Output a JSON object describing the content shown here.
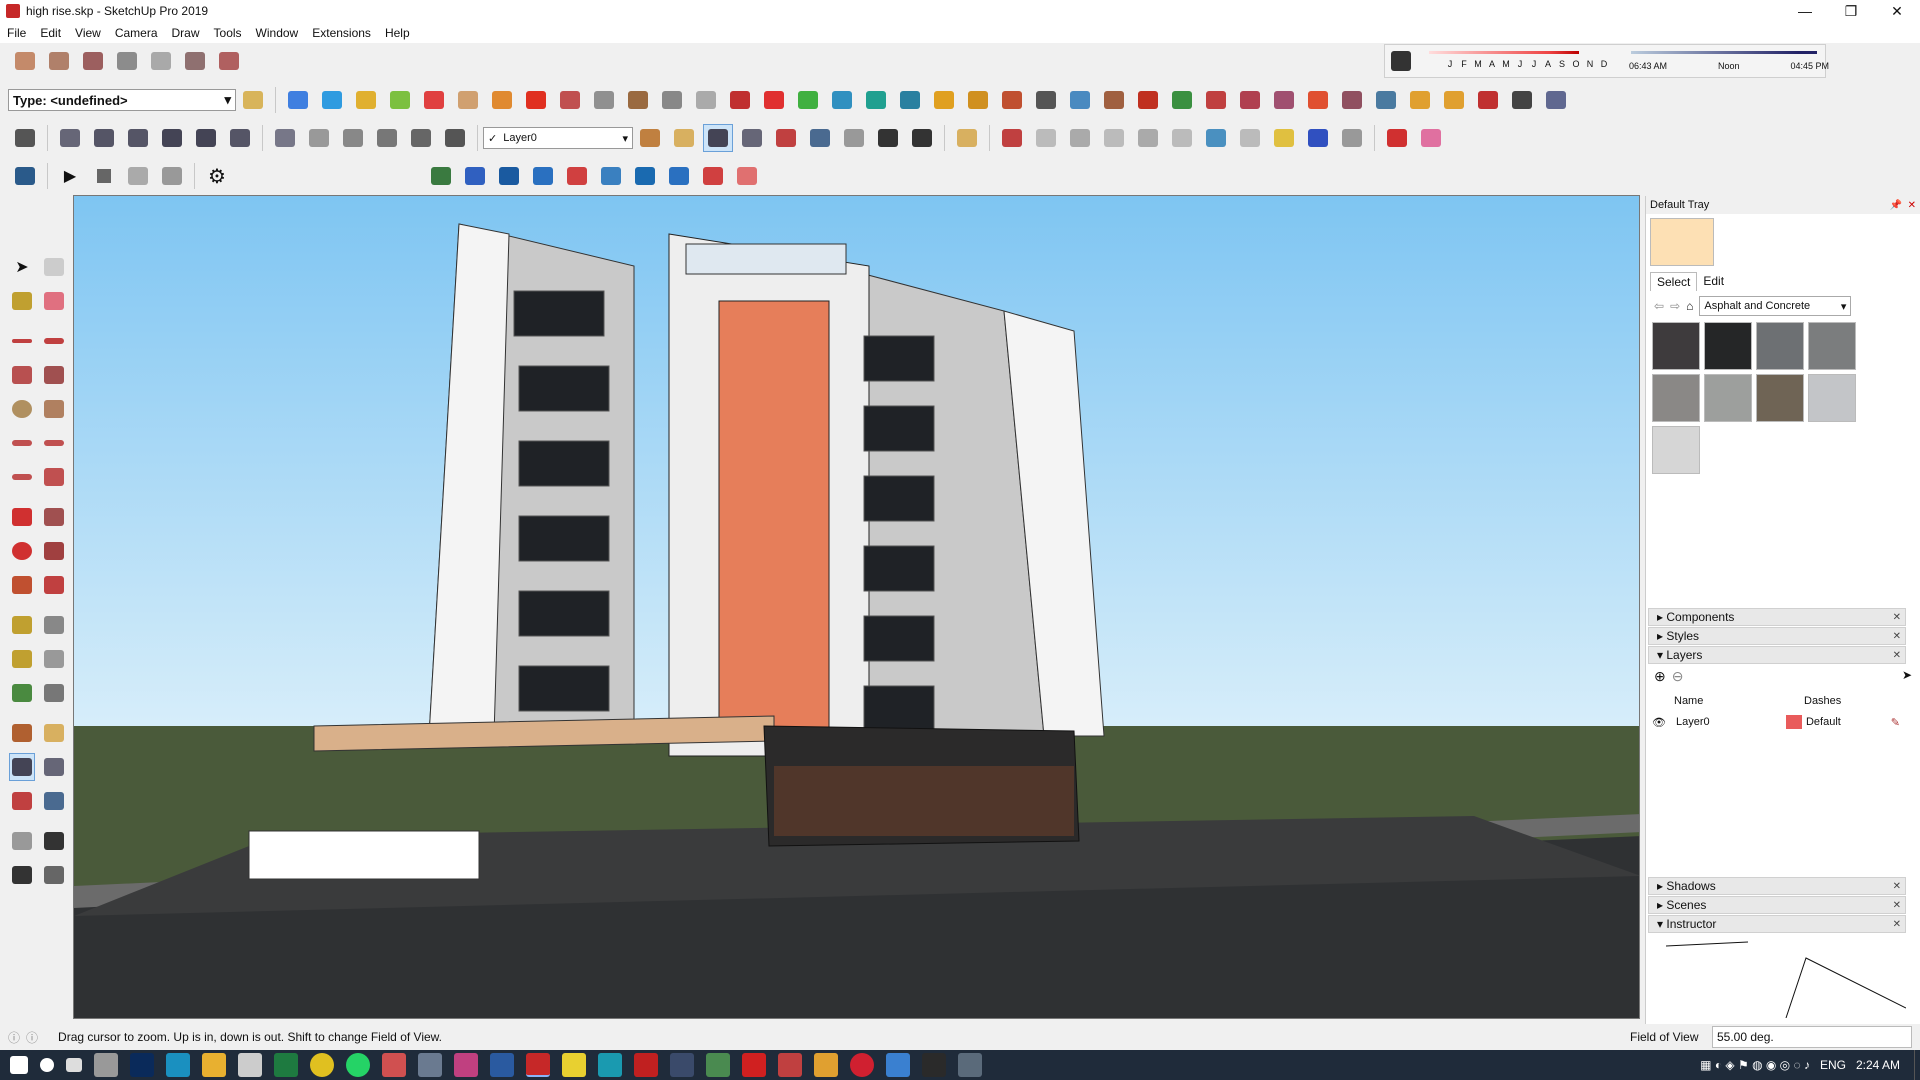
{
  "window": {
    "title": "high rise.skp - SketchUp Pro 2019",
    "minimize": "—",
    "restore": "❐",
    "close": "✕"
  },
  "menu": [
    "File",
    "Edit",
    "View",
    "Camera",
    "Draw",
    "Tools",
    "Window",
    "Extensions",
    "Help"
  ],
  "toolbar": {
    "type_label": "Type: <undefined>",
    "layer_label": "Layer0",
    "layer_check": "✓"
  },
  "shadow_panel": {
    "months": [
      "J",
      "F",
      "M",
      "A",
      "M",
      "J",
      "J",
      "A",
      "S",
      "O",
      "N",
      "D"
    ],
    "time_start": "06:43 AM",
    "time_mid": "Noon",
    "time_end": "04:45 PM"
  },
  "tray": {
    "title": "Default Tray",
    "tab_select": "Select",
    "tab_edit": "Edit",
    "material_dropdown": "Asphalt and Concrete",
    "swatch_colors": [
      "#3e3b3d",
      "#252627",
      "#6d7073",
      "#7b7d7e",
      "#8a8886",
      "#9d9f9d",
      "#6f6455",
      "#c3c5c8",
      "#d6d6d6"
    ],
    "current_color": "#fde0b4",
    "sections": {
      "components": "Components",
      "styles": "Styles",
      "layers": "Layers",
      "shadows": "Shadows",
      "scenes": "Scenes",
      "instructor": "Instructor"
    },
    "layers_table": {
      "col_name": "Name",
      "col_dashes": "Dashes",
      "row_name": "Layer0",
      "row_dashes": "Default",
      "row_color": "#e95b5b"
    }
  },
  "status": {
    "message": "Drag cursor to zoom.  Up is in, down is out. Shift to change Field of View.",
    "vcb_label": "Field of View",
    "vcb_value": "55.00 deg."
  },
  "taskbar": {
    "lang": "ENG",
    "clock": "2:24 AM"
  },
  "colors": {
    "sky_top": "#7ec5f2",
    "sky_bottom": "#d8eefa",
    "grass": "#4a5a3a",
    "road": "#2f3133",
    "accent": "#e67e5a"
  }
}
